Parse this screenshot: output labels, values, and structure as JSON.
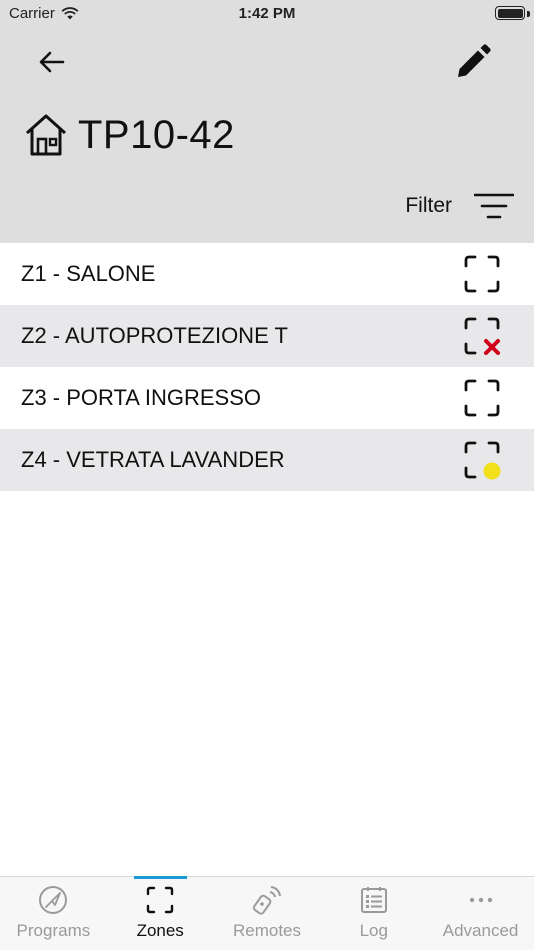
{
  "status_bar": {
    "carrier": "Carrier",
    "time": "1:42 PM"
  },
  "header": {
    "site_name": "TP10-42",
    "filter_label": "Filter"
  },
  "zones": [
    {
      "label": "Z1 - SALONE",
      "status": "normal"
    },
    {
      "label": "Z2 - AUTOPROTEZIONE T",
      "status": "error"
    },
    {
      "label": "Z3 - PORTA INGRESSO",
      "status": "normal"
    },
    {
      "label": "Z4 - VETRATA LAVANDER",
      "status": "warning"
    }
  ],
  "tabs": [
    {
      "label": "Programs",
      "icon": "programs-icon"
    },
    {
      "label": "Zones",
      "icon": "zones-icon",
      "active": true
    },
    {
      "label": "Remotes",
      "icon": "remotes-icon"
    },
    {
      "label": "Log",
      "icon": "log-icon"
    },
    {
      "label": "Advanced",
      "icon": "more-icon"
    }
  ],
  "colors": {
    "error": "#d0021b",
    "warning": "#f2e01a",
    "accent": "#1a9ad6",
    "header_bg": "#dedede"
  }
}
